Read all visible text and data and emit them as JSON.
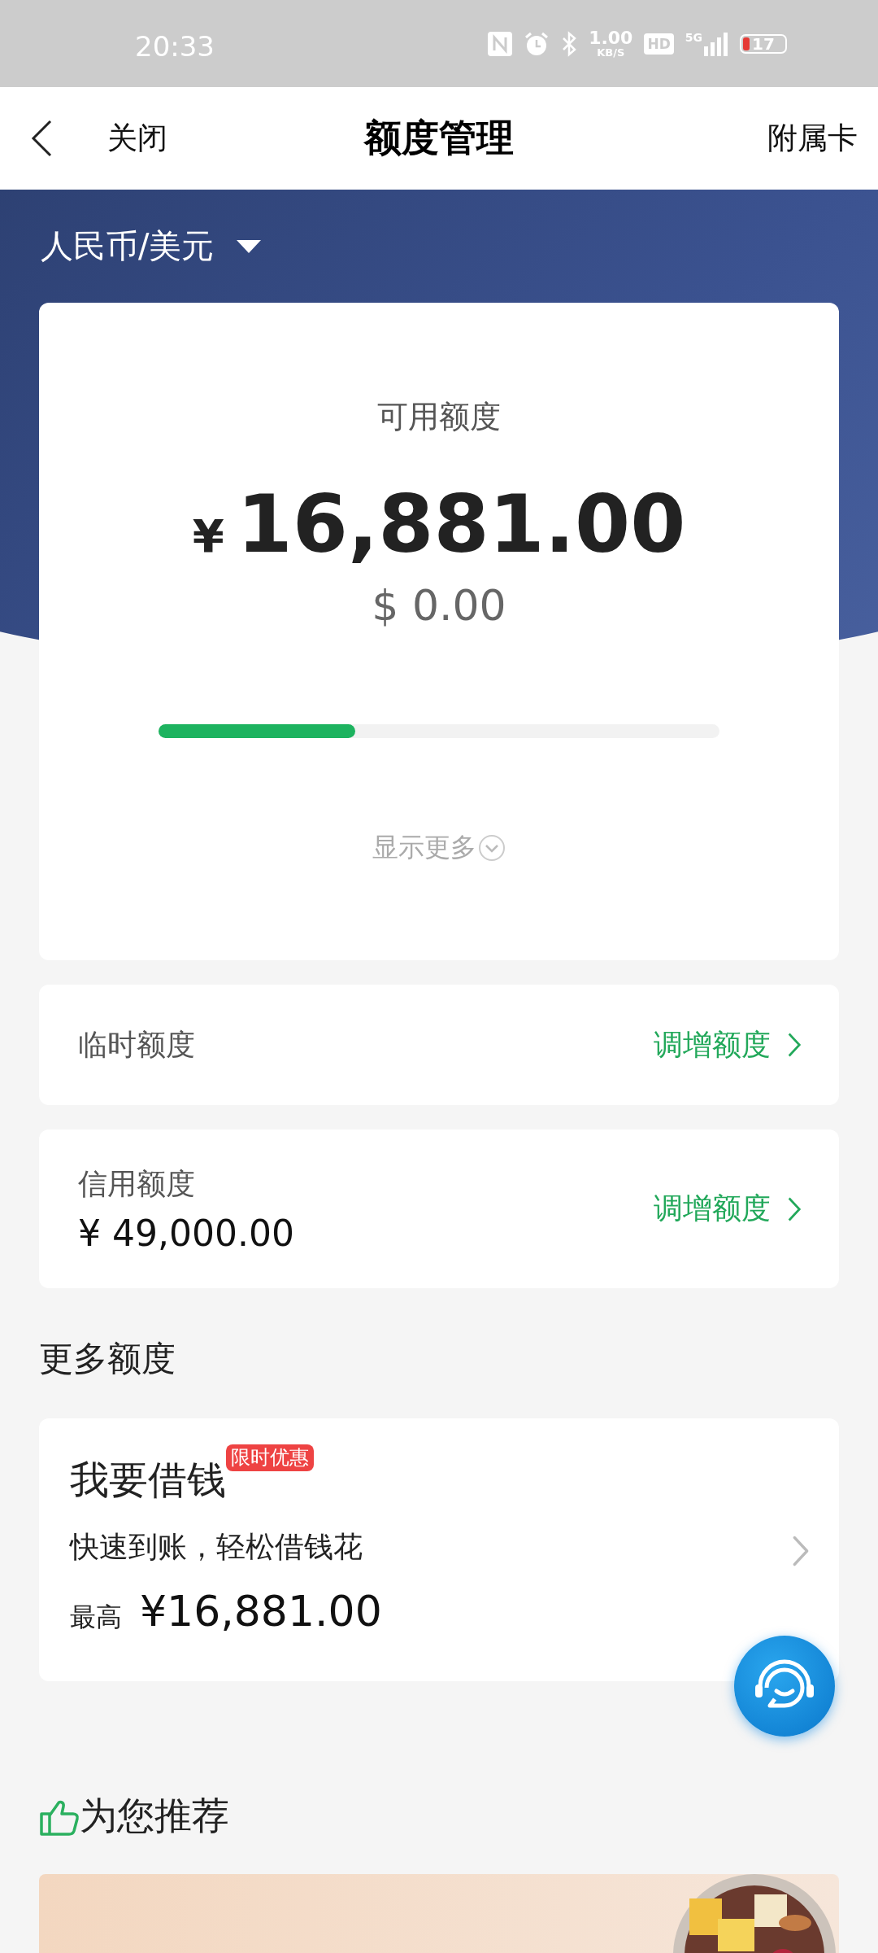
{
  "status_bar": {
    "time": "20:33",
    "net_speed": "1.00",
    "net_unit": "KB/S",
    "hd": "HD",
    "network": "5G",
    "battery": "17"
  },
  "header": {
    "back_label": "关闭",
    "title": "额度管理",
    "action": "附属卡"
  },
  "currency": {
    "label": "人民币/美元"
  },
  "available": {
    "label": "可用额度",
    "symbol": "¥",
    "amount": "16,881.00",
    "secondary": "$ 0.00",
    "level": 0.35,
    "more": "显示更多"
  },
  "limits": [
    {
      "label": "临时额度",
      "action": "调增额度"
    },
    {
      "label": "信用额度",
      "value": "¥ 49,000.00",
      "action": "调增额度"
    }
  ],
  "more_section": {
    "title": "更多额度"
  },
  "loan": {
    "title": "我要借钱",
    "badge": "限时优惠",
    "subtitle": "快速到账，轻松借钱花",
    "max_label": "最高",
    "max_value": "¥16,881.00"
  },
  "recommend": {
    "title": "为您推荐"
  }
}
